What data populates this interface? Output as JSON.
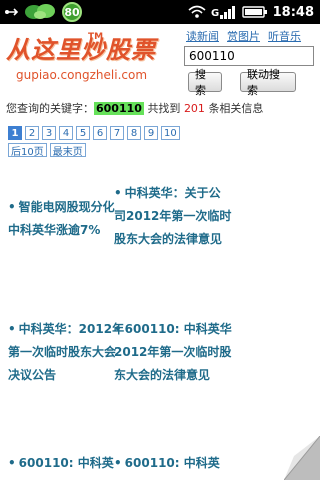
{
  "status_bar": {
    "badge": "80",
    "time": "18:48",
    "icons": [
      "usb-icon",
      "app-bubbles-icon",
      "wifi-icon",
      "signal-icon",
      "battery-icon"
    ]
  },
  "header": {
    "logo_title": "从这里炒股票",
    "logo_tm": "TM",
    "logo_url": "gupiao.congzheli.com"
  },
  "top_links": [
    "读新闻",
    "赏图片",
    "听音乐"
  ],
  "search": {
    "value": "600110",
    "search_button": "搜索",
    "joint_search_button": "联动搜索"
  },
  "summary": {
    "prefix": "您查询的关键字：",
    "keyword": "600110",
    "middle": "共找到",
    "count": "201",
    "suffix": "条相关信息"
  },
  "pagination": {
    "pages": [
      "1",
      "2",
      "3",
      "4",
      "5",
      "6",
      "7",
      "8",
      "9",
      "10"
    ],
    "next10": "后10页",
    "last": "最末页"
  },
  "articles": [
    {
      "text": "智能电网股现分化 中科英华涨逾7%"
    },
    {
      "text": "中科英华：关于公司2012年第一次临时股东大会的法律意见"
    },
    {
      "text": "中科英华：2012年第一次临时股东大会决议公告"
    },
    {
      "text": "600110: 中科英华2012年第一次临时股东大会的法律意见"
    },
    {
      "text": "600110: 中科英"
    },
    {
      "text": "600110: 中科英"
    }
  ],
  "colors": {
    "accent_link": "#2b6cb0",
    "logo": "#e0532b",
    "keyword_highlight": "#66e15a",
    "count": "#d81b1b",
    "article": "#1f6b8a"
  }
}
